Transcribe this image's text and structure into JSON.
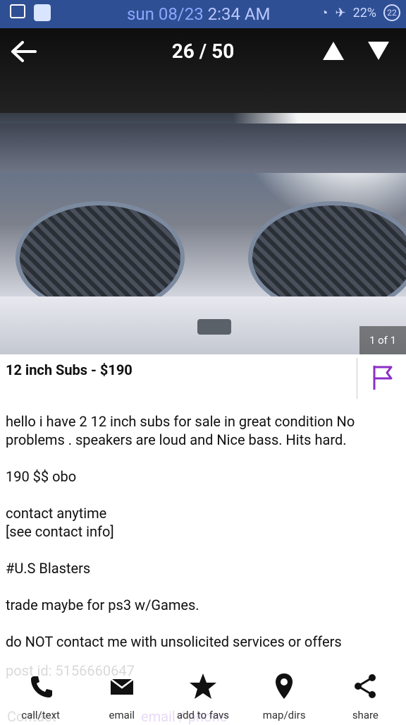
{
  "status_bar": {
    "date_text": "sun 08/23",
    "time_text": "2:34 AM",
    "battery_percent": "22%",
    "battery_badge": "22"
  },
  "nav": {
    "counter": "26 / 50"
  },
  "photo": {
    "counter": "1 of 1"
  },
  "listing": {
    "title": "12 inch Subs - $190",
    "description": "hello i have 2 12 inch subs for sale in great condition No problems . speakers are loud and Nice bass. Hits hard.\n\n190 $$ obo\n\ncontact anytime\n [see contact info]\n\n#U.S Blasters\n\ntrade maybe for ps3 w/Games.\n\ndo NOT contact me with unsolicited services or offers",
    "post_id": "post id: 5156660647",
    "contact_ghost": "Contact",
    "contact_ghost_2": "email / phone"
  },
  "actions": {
    "call_text": "call/text",
    "email": "email",
    "add_to_favs": "add to favs",
    "map_dirs": "map/dirs",
    "share": "share"
  },
  "colors": {
    "status_bar": "#2f4f94",
    "flag": "#8b2fc9",
    "icon": "#111111"
  }
}
